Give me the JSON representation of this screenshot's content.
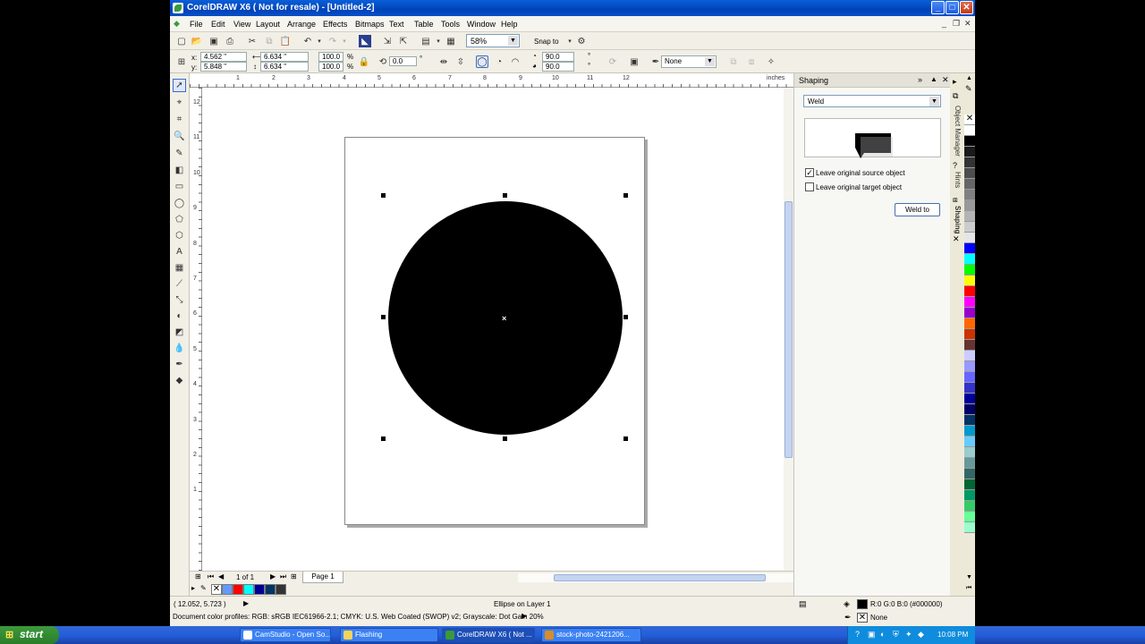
{
  "window": {
    "title": "CorelDRAW X6 ( Not for resale) - [Untitled-2]",
    "minimize": "_",
    "maximize": "□",
    "close": "✕"
  },
  "menu": {
    "items": [
      "File",
      "Edit",
      "View",
      "Layout",
      "Arrange",
      "Effects",
      "Bitmaps",
      "Text",
      "Table",
      "Tools",
      "Window",
      "Help"
    ],
    "mdi_buttons": [
      "_",
      "❐",
      "✕"
    ]
  },
  "standard_toolbar": {
    "zoom": "58%",
    "snap_to": "Snap to"
  },
  "property_bar": {
    "x_label": "x:",
    "y_label": "y:",
    "x_value": "4.562 \"",
    "y_value": "5.848 \"",
    "width": "6.634 \"",
    "height": "6.634 \"",
    "scale_x": "100.0",
    "scale_y": "100.0",
    "percent": "%",
    "rotation": "0.0",
    "degree": "°",
    "start_angle": "90.0",
    "end_angle": "90.0",
    "outline": "None"
  },
  "ruler": {
    "unit": "inches",
    "h_ticks": [
      "1",
      "2",
      "3",
      "4",
      "5",
      "6",
      "7",
      "8",
      "9",
      "10",
      "11",
      "12"
    ],
    "v_ticks": [
      "12",
      "11",
      "10",
      "9",
      "8",
      "7",
      "6",
      "5",
      "4",
      "3",
      "2",
      "1"
    ]
  },
  "page_nav": {
    "counter": "1 of 1",
    "page_tab": "Page 1"
  },
  "docker": {
    "title": "Shaping",
    "operation": "Weld",
    "leave_source": {
      "label": "Leave original source object",
      "checked": true
    },
    "leave_target": {
      "label": "Leave original target object",
      "checked": false
    },
    "apply_button": "Weld to",
    "side_tabs": [
      "Object Manager",
      "Hints",
      "Shaping"
    ]
  },
  "palette_colors": [
    "#ffffff",
    "#000000",
    "#1a1a1a",
    "#333333",
    "#4d4d4d",
    "#666666",
    "#808080",
    "#999999",
    "#b3b3b3",
    "#cccccc",
    "#e6e6e6",
    "#0000ff",
    "#00ffff",
    "#00ff00",
    "#ffff00",
    "#ff0000",
    "#ff00ff",
    "#9900cc",
    "#ff6600",
    "#cc3300",
    "#663333",
    "#ccccff",
    "#9999ff",
    "#6666ff",
    "#3333cc",
    "#000099",
    "#000066",
    "#003366",
    "#0099cc",
    "#66ccff",
    "#99cccc",
    "#669999",
    "#336666",
    "#006633",
    "#009966",
    "#33cc66",
    "#66ff99",
    "#99ffcc"
  ],
  "doc_palette_colors": [
    "#6699ff",
    "#ff0000",
    "#00ffff",
    "#000099",
    "#003366",
    "#333333"
  ],
  "status": {
    "cursor_position": "( 12.052, 5.723 )",
    "object_info": "Ellipse on Layer 1",
    "color_profiles": "Document color profiles: RGB: sRGB IEC61966-2.1; CMYK: U.S. Web Coated (SWOP) v2; Grayscale: Dot Gain 20%",
    "fill_info": "R:0 G:0 B:0 (#000000)",
    "outline_info": "None"
  },
  "taskbar": {
    "start": "start",
    "tasks": [
      "CamStudio - Open So...",
      "Flashing",
      "CorelDRAW X6 ( Not ...",
      "stock-photo-2421206..."
    ],
    "active_task": 2,
    "clock": "10:08 PM"
  }
}
